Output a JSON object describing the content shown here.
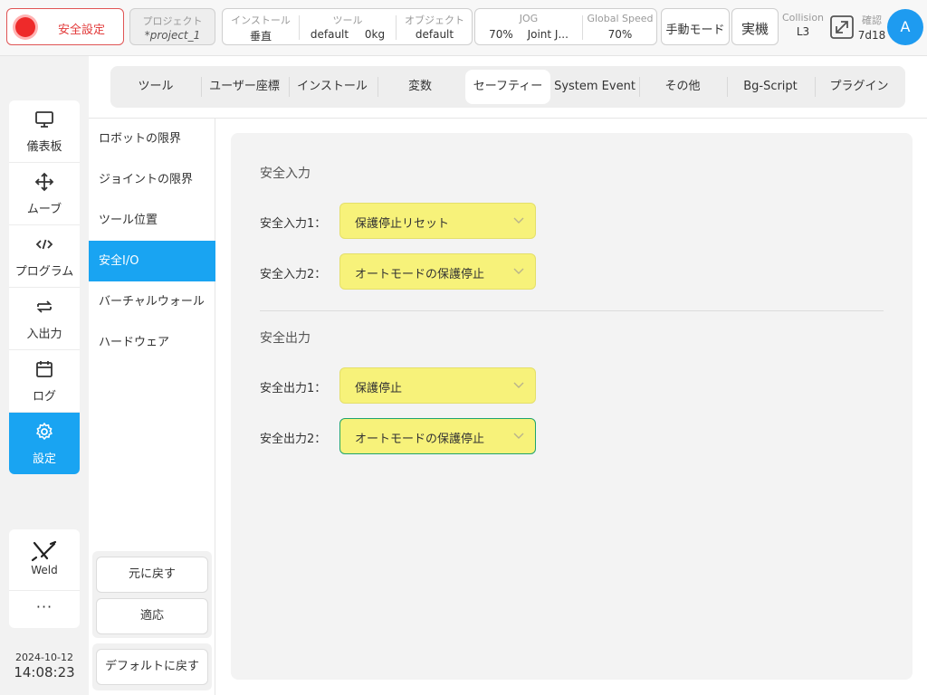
{
  "topbar": {
    "safety_label": "安全設定",
    "project": {
      "label": "プロジェクト",
      "value": "*project_1"
    },
    "install": {
      "label": "インストール",
      "value": "垂直"
    },
    "tool": {
      "label": "ツール",
      "value_name": "default",
      "value_weight": "0kg"
    },
    "object": {
      "label": "オブジェクト",
      "value": "default"
    },
    "jog": {
      "label": "JOG",
      "speed": "70%",
      "mode": "Joint J..."
    },
    "global_speed": {
      "label": "Global Speed",
      "value": "70%"
    },
    "manual_mode": "手動モード",
    "real_machine": "実機",
    "collision": {
      "label": "Collision",
      "value": "L3"
    },
    "confirm": {
      "label": "確認",
      "value": "7d18"
    },
    "avatar": "A"
  },
  "leftnav": {
    "items": [
      {
        "label": "儀表板",
        "icon": "monitor-icon"
      },
      {
        "label": "ムーブ",
        "icon": "move-icon"
      },
      {
        "label": "プログラム",
        "icon": "code-icon"
      },
      {
        "label": "入出力",
        "icon": "swap-icon"
      },
      {
        "label": "ログ",
        "icon": "calendar-icon"
      },
      {
        "label": "設定",
        "icon": "gear-icon",
        "active": true
      }
    ],
    "weld_label": "Weld",
    "more_label": "···",
    "date": "2024-10-12",
    "time": "14:08:23"
  },
  "tabs": [
    "ツール",
    "ユーザー座標",
    "インストール",
    "変数",
    "セーフティー",
    "System Event",
    "その他",
    "Bg-Script",
    "プラグイン"
  ],
  "active_tab": "セーフティー",
  "subnav": {
    "items": [
      "ロボットの限界",
      "ジョイントの限界",
      "ツール位置",
      "安全I/O",
      "バーチャルウォール",
      "ハードウェア"
    ],
    "active": "安全I/O",
    "revert_label": "元に戻す",
    "apply_label": "適応",
    "default_label": "デフォルトに戻す"
  },
  "safety_io": {
    "input_title": "安全入力",
    "inputs": [
      {
        "label": "安全入力1：",
        "value": "保護停止リセット"
      },
      {
        "label": "安全入力2：",
        "value": "オートモードの保護停止"
      }
    ],
    "output_title": "安全出力",
    "outputs": [
      {
        "label": "安全出力1：",
        "value": "保護停止"
      },
      {
        "label": "安全出力2：",
        "value": "オートモードの保護停止"
      }
    ]
  },
  "colors": {
    "accent": "#19a4f2",
    "select_bg": "#f7f27a",
    "danger": "#ee2a2a"
  }
}
